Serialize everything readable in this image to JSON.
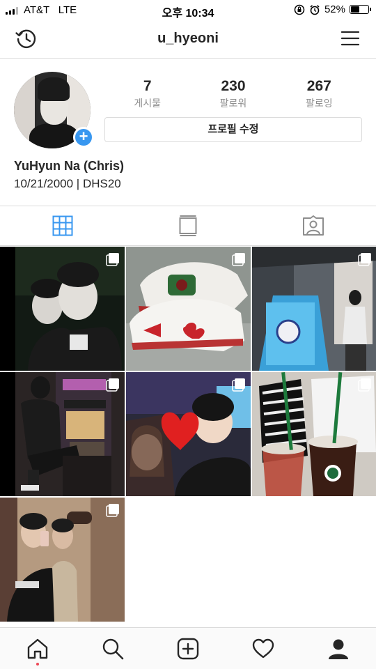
{
  "status_bar": {
    "carrier": "AT&T",
    "network": "LTE",
    "time": "오후 10:34",
    "battery_percent": "52%",
    "battery_level": 0.52
  },
  "header": {
    "username": "u_hyeoni",
    "left_icon": "history-icon",
    "right_icon": "hamburger-menu-icon"
  },
  "profile": {
    "stats": [
      {
        "count": "7",
        "label": "게시물"
      },
      {
        "count": "230",
        "label": "팔로워"
      },
      {
        "count": "267",
        "label": "팔로잉"
      }
    ],
    "edit_button": "프로필 수정",
    "add_story": "+",
    "name": "YuHyun Na (Chris)",
    "bio": "10/21/2000 | DHS20"
  },
  "tabs": [
    "grid-icon",
    "feed-list-icon",
    "tagged-icon"
  ],
  "colors": {
    "accent": "#3897f0",
    "active_tab": "#3897f0",
    "notification_dot": "#ed4956",
    "border": "#dbdbdb"
  },
  "posts": [
    {
      "subject": "selfie with face masks",
      "multi": true
    },
    {
      "subject": "white sneakers",
      "multi": true
    },
    {
      "subject": "mirror selfie in store",
      "multi": true
    },
    {
      "subject": "sitting at night street",
      "multi": true
    },
    {
      "subject": "heart sticker photo",
      "multi": true
    },
    {
      "subject": "iced drinks",
      "multi": true
    },
    {
      "subject": "mirror selfie two friends",
      "multi": true
    }
  ],
  "bottom_nav": [
    "home-icon",
    "search-icon",
    "add-post-icon",
    "activity-heart-icon",
    "profile-icon"
  ]
}
